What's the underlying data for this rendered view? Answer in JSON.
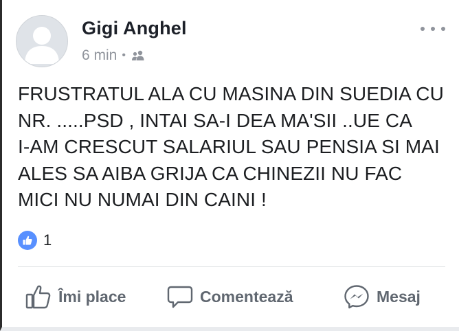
{
  "post": {
    "author": "Gigi Anghel",
    "time": "6 min",
    "separator": "•",
    "audience_icon": "friends-icon",
    "text_lines": [
      "FRUSTRATUL ALA CU MASINA DIN SUEDIA CU",
      "NR. .....PSD , INTAI SA-I DEA MA'SII ..UE CA",
      "I-AM CRESCUT SALARIUL SAU PENSIA SI MAI",
      "ALES SA AIBA GRIJA CA CHINEZII NU FAC",
      "MICI NU NUMAI DIN CAINI !"
    ],
    "reactions": {
      "icon": "like-reaction-icon",
      "count": "1"
    }
  },
  "actions": {
    "like": "Îmi place",
    "comment": "Comentează",
    "message": "Mesaj"
  },
  "colors": {
    "like_badge": "#5890ff",
    "meta_gray": "#90949c",
    "action_gray": "#606770"
  }
}
